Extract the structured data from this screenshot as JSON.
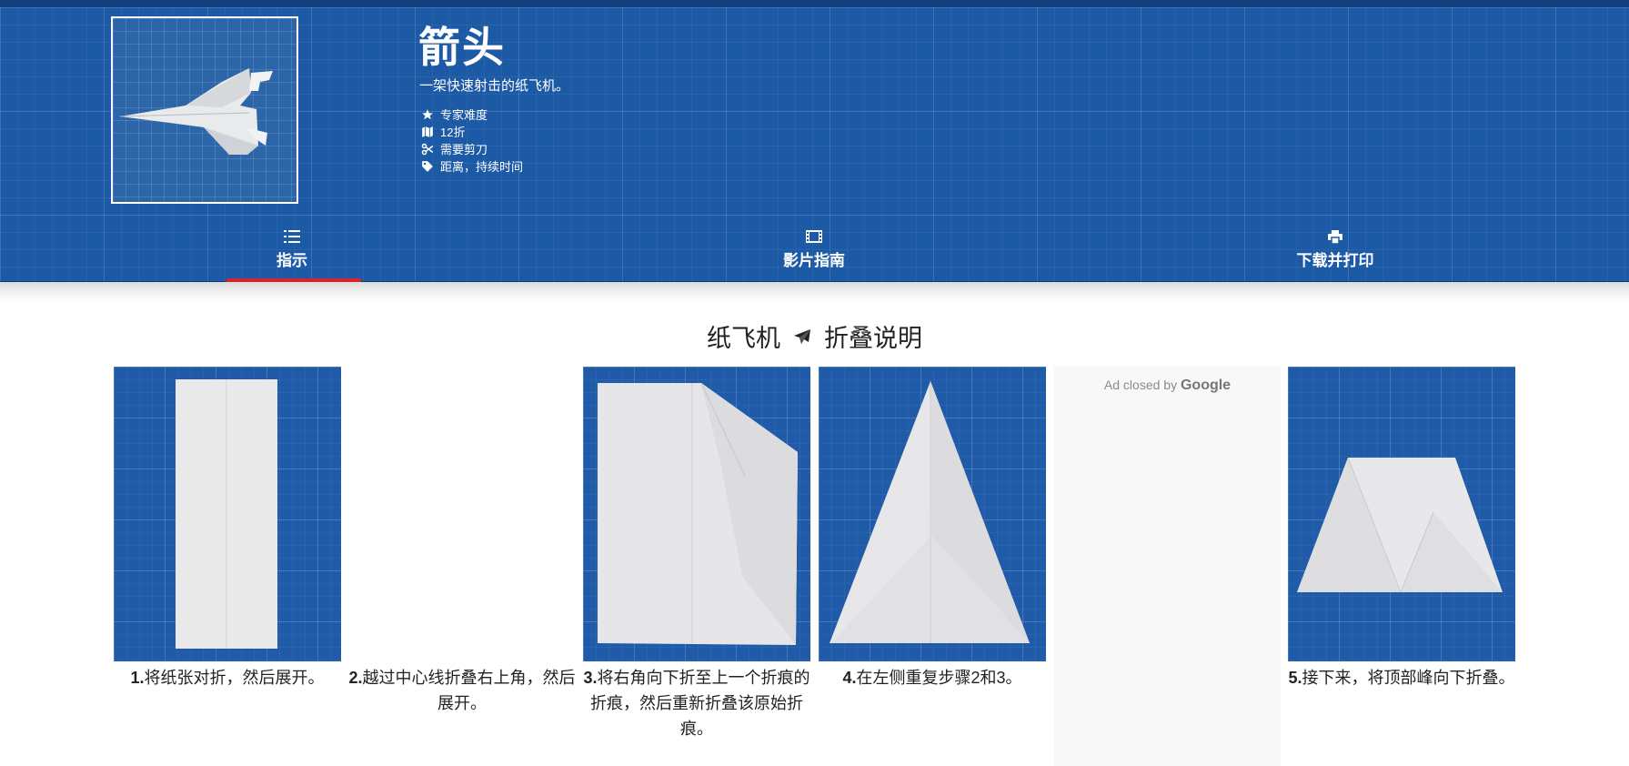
{
  "header": {
    "title": "箭头",
    "subtitle": "一架快速射击的纸飞机。",
    "meta": [
      {
        "icon": "star-icon",
        "text": "专家难度"
      },
      {
        "icon": "map-icon",
        "text": "12折"
      },
      {
        "icon": "scissors-icon",
        "text": "需要剪刀"
      },
      {
        "icon": "tag-icon",
        "text": "距离，持续时间"
      }
    ],
    "tabs": [
      {
        "icon": "list-icon",
        "label": "指示",
        "active": true
      },
      {
        "icon": "film-icon",
        "label": "影片指南",
        "active": false
      },
      {
        "icon": "print-icon",
        "label": "下载并打印",
        "active": false
      }
    ]
  },
  "section": {
    "title_left": "纸飞机",
    "title_right": "折叠说明"
  },
  "steps": [
    {
      "num": "1.",
      "text": "将纸张对折，然后展开。"
    },
    {
      "num": "2.",
      "text": "越过中心线折叠右上角，然后展开。"
    },
    {
      "num": "3.",
      "text": "将右角向下折至上一个折痕的折痕，然后重新折叠该原始折痕。"
    },
    {
      "num": "4.",
      "text": "在左侧重复步骤2和3。"
    },
    {
      "num": "5.",
      "text": "接下来，将顶部峰向下折叠。"
    }
  ],
  "ad": {
    "text": "Ad closed by",
    "brand": "Google"
  },
  "colors": {
    "header_blue": "#1c5aa6",
    "active_underline": "#d6232d"
  }
}
